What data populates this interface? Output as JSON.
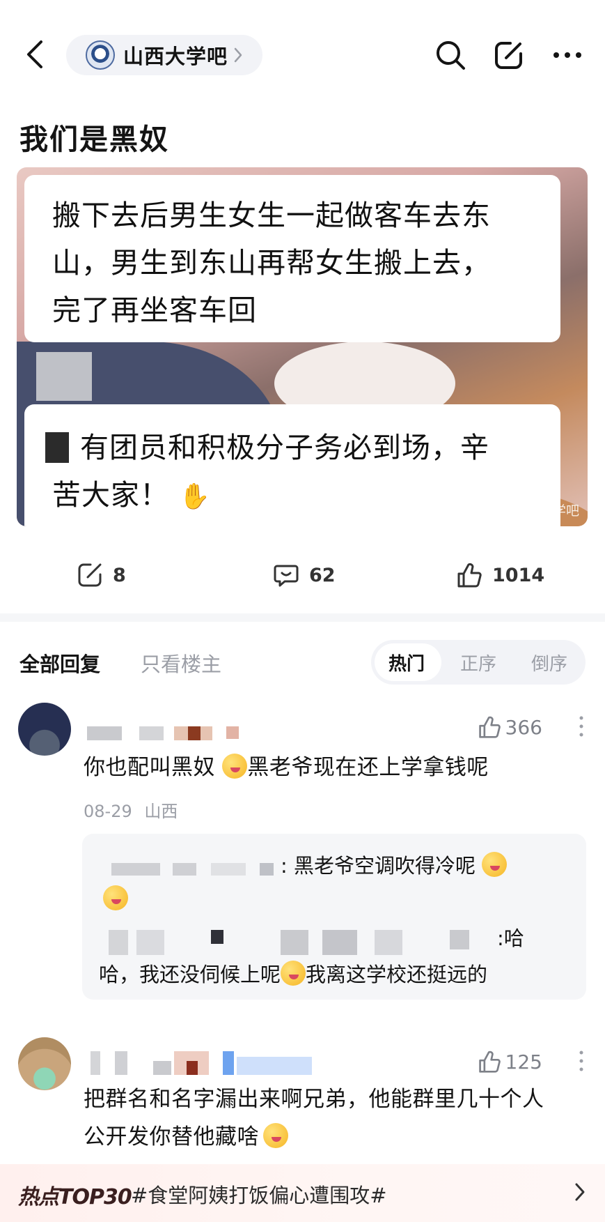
{
  "header": {
    "forum_name": "山西大学吧",
    "icons": [
      "back-icon",
      "chevron-right-icon",
      "search-icon",
      "edit-icon",
      "more-icon"
    ]
  },
  "post": {
    "title": "我们是黑奴",
    "image": {
      "bubble1_lines": [
        "搬下去后男生女生一起做客车去东",
        "山，男生到东山再帮女生搬上去，",
        "完了再坐客车回"
      ],
      "bubble2_lines": [
        "有团员和积极分子务必到场，辛",
        "苦大家！"
      ],
      "watermark": "大学吧"
    },
    "actions": {
      "share_count": "8",
      "comment_count": "62",
      "like_count": "1014"
    }
  },
  "reply_tabs": {
    "all": "全部回复",
    "op_only": "只看楼主",
    "sort": [
      "热门",
      "正序",
      "倒序"
    ],
    "sort_selected": "热门"
  },
  "comments": [
    {
      "text_before": "你也配叫黑奴",
      "text_after": "黑老爷现在还上学拿钱呢",
      "likes": "366",
      "date": "08-29",
      "location": "山西",
      "replies": [
        {
          "text": ": 黑老爷空调吹得冷呢"
        },
        {
          "text_head": ":哈",
          "text_line2a": "哈，我还没伺候上呢",
          "text_line2b": "我离这学校还挺远的"
        }
      ]
    },
    {
      "text_line1": "把群名和名字漏出来啊兄弟，他能群里几十个人",
      "text_line2": "公开发你替他藏啥",
      "likes": "125"
    }
  ],
  "hot_bar": {
    "badge": "热点TOP30",
    "topic": "#食堂阿姨打饭偏心遭围攻#"
  },
  "colors": {
    "pill_bg": "#f2f3f7",
    "muted_text": "#9b9ea6",
    "hot_bar_bg": "#fff0ee"
  }
}
